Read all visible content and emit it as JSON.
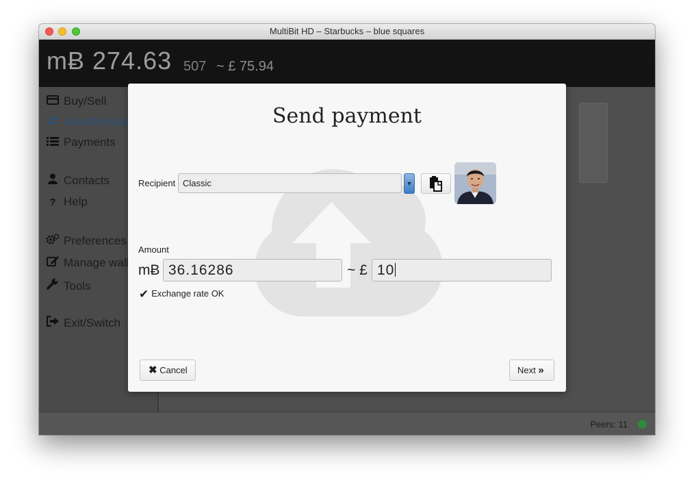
{
  "window": {
    "title": "MultiBit HD – Starbucks – blue squares"
  },
  "balance": {
    "main": "mɃ 274.63",
    "sub_digits": "507",
    "fiat": "~ £ 75.94"
  },
  "sidebar": {
    "items": [
      {
        "label": "Buy/Sell",
        "icon": "credit-card-icon"
      },
      {
        "label": "Send/Reque",
        "icon": "exchange-arrows-icon"
      },
      {
        "label": "Payments",
        "icon": "list-icon"
      },
      {
        "label": "Contacts",
        "icon": "user-icon"
      },
      {
        "label": "Help",
        "icon": "question-icon"
      },
      {
        "label": "Preferences",
        "icon": "gears-icon"
      },
      {
        "label": "Manage wall",
        "icon": "edit-icon"
      },
      {
        "label": "Tools",
        "icon": "wrench-icon"
      },
      {
        "label": "Exit/Switch",
        "icon": "sign-out-icon"
      }
    ]
  },
  "dialog": {
    "title": "Send payment",
    "recipient_label": "Recipient",
    "recipient_value": "Classic",
    "amount_label": "Amount",
    "btc_prefix": "mɃ",
    "btc_amount": "36.16286",
    "fiat_prefix": "~ £",
    "fiat_amount": "10",
    "exchange_status": "Exchange rate OK",
    "cancel_label": "Cancel",
    "next_label": "Next"
  },
  "status": {
    "peers": "Peers: 11",
    "peer_color": "#2e8a3c"
  },
  "colors": {
    "accent": "#2b4f74",
    "combo_arrow": "#3d7bc6"
  }
}
